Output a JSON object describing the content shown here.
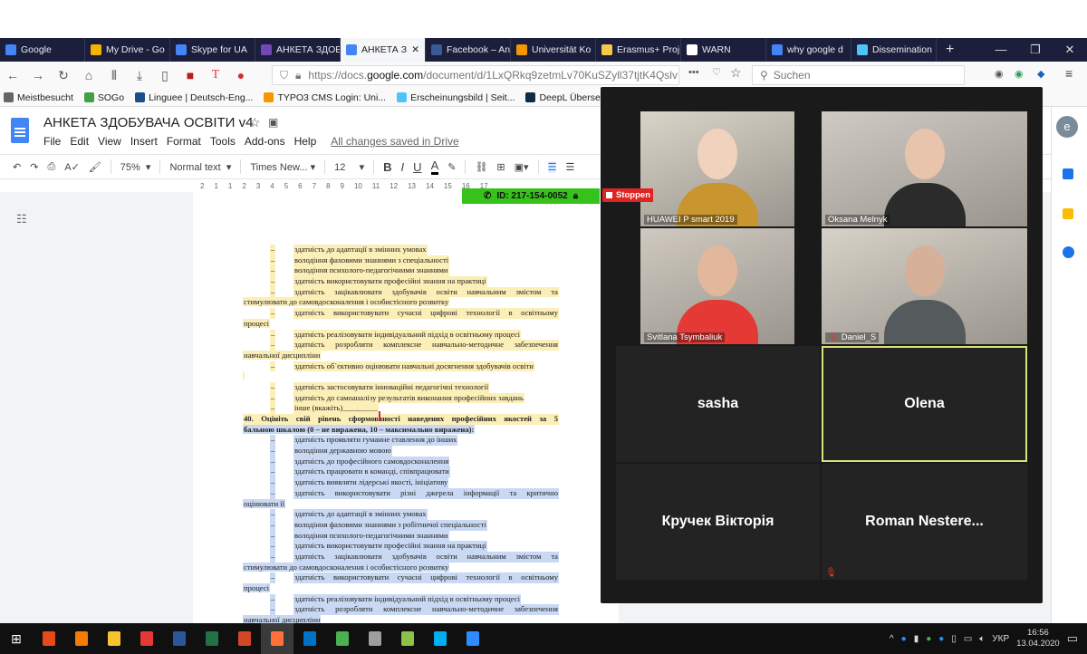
{
  "browser": {
    "tabs": [
      {
        "label": "Google",
        "icon": "google-icon",
        "color": "#4285f4"
      },
      {
        "label": "My Drive - Go",
        "icon": "drive-icon",
        "color": "#f4b400"
      },
      {
        "label": "Skype for UA",
        "icon": "docs-icon",
        "color": "#4285f4"
      },
      {
        "label": "АНКЕТА ЗДОБ",
        "icon": "forms-icon",
        "color": "#7248b9"
      },
      {
        "label": "АНКЕТА З",
        "icon": "docs-icon",
        "color": "#4285f4",
        "active": true
      },
      {
        "label": "Facebook – An",
        "icon": "facebook-icon",
        "color": "#3b5998"
      },
      {
        "label": "Universität Ko",
        "icon": "typo3-icon",
        "color": "#f49700"
      },
      {
        "label": "Erasmus+ Proj",
        "icon": "page-icon",
        "color": "#f7c948"
      },
      {
        "label": "WARN",
        "icon": "globe-icon",
        "color": "#ffffff"
      },
      {
        "label": "why google d",
        "icon": "google-icon",
        "color": "#4285f4"
      },
      {
        "label": "Dissemination",
        "icon": "page-icon",
        "color": "#4fc3f7"
      }
    ],
    "url": {
      "prefix": "https://docs.",
      "domain": "google.com",
      "path": "/document/d/1LxQRkq9zetmLv70KuSZyll37tjtK4Qslv"
    },
    "search_placeholder": "Suchen",
    "bookmarks": [
      {
        "label": "Meistbesucht",
        "color": "#666666"
      },
      {
        "label": "SOGo",
        "color": "#43a047"
      },
      {
        "label": "Linguee | Deutsch-Eng...",
        "color": "#1a4f8b"
      },
      {
        "label": "TYPO3 CMS Login: Uni...",
        "color": "#f49700"
      },
      {
        "label": "Erscheinungsbild | Seit...",
        "color": "#4fc3f7"
      },
      {
        "label": "DeepL Übersetzer",
        "color": "#0f2b46"
      },
      {
        "label": "Словарь",
        "color": "#3f7fd8"
      }
    ]
  },
  "docs": {
    "title": "АНКЕТА ЗДОБУВАЧА ОСВІТИ v4",
    "menus": [
      "File",
      "Edit",
      "View",
      "Insert",
      "Format",
      "Tools",
      "Add-ons",
      "Help"
    ],
    "saved_status": "All changes saved in Drive",
    "toolbar": {
      "zoom": "75%",
      "style": "Normal text",
      "font": "Times New...",
      "size": "12"
    },
    "ruler": [
      "2",
      "1",
      "1",
      "2",
      "3",
      "4",
      "5",
      "6",
      "7",
      "8",
      "9",
      "10",
      "11",
      "12",
      "13",
      "14",
      "15",
      "16",
      "17"
    ],
    "lines": [
      {
        "type": "item",
        "hl": "y",
        "text": "здатність до адаптації в змінних умовах"
      },
      {
        "type": "item",
        "hl": "y",
        "text": "володіння фаховими знаннями з спеціальності"
      },
      {
        "type": "item",
        "hl": "y",
        "text": "володіння психолого-педагогічними знаннями"
      },
      {
        "type": "item",
        "hl": "y",
        "text": "здатність використовувати професійні знання на практиці"
      },
      {
        "type": "item just",
        "hl": "y",
        "text": "здатність зацікавлювати здобувачів освіти навчальним змістом та"
      },
      {
        "type": "cont",
        "hl": "y",
        "text": "стимулювати до самовдосконалення і особистісного розвитку"
      },
      {
        "type": "item just",
        "hl": "y",
        "text": "здатність використовувати сучасні цифрові технології в освітньому"
      },
      {
        "type": "cont",
        "hl": "y",
        "text": "процесі"
      },
      {
        "type": "item",
        "hl": "y",
        "text": "здатність реалізовувати індивідуальний підхід в освітньому процесі"
      },
      {
        "type": "item just",
        "hl": "y",
        "text": "здатність розробляти комплексне навчально-методичне забезпечення"
      },
      {
        "type": "cont",
        "hl": "y",
        "text": "навчальної дисципліни"
      },
      {
        "type": "item",
        "hl": "y",
        "text": "здатність об`єктивно оцінювати навчальні досягнення здобувачів освіти"
      },
      {
        "type": "cont",
        "hl": "y",
        "text": "      "
      },
      {
        "type": "item",
        "hl": "y",
        "text": "здатність застосовувати інноваційні педагогічні технології"
      },
      {
        "type": "item",
        "hl": "y",
        "text": "здатність до самоаналізу результатів виконання професійних завдань"
      },
      {
        "type": "item",
        "hl": "y",
        "text": "інше (вкажіть)_________"
      },
      {
        "type": "head",
        "hl": "y",
        "text": "40. Оцініть свій рівень сформованості наведених професійних якостей за 5"
      },
      {
        "type": "headend",
        "hl": "b",
        "text": "бальною шкалою (0 – не виражена, 10 – максимально виражена):"
      },
      {
        "type": "item",
        "hl": "b",
        "text": "здатність проявляти гуманне ставлення до інших"
      },
      {
        "type": "item",
        "hl": "b",
        "text": "володіння державною мовою"
      },
      {
        "type": "item",
        "hl": "b",
        "text": "здатність до професійного самовдосконалення"
      },
      {
        "type": "item",
        "hl": "b",
        "text": "здатність працювати в команді, співпрацювати"
      },
      {
        "type": "item",
        "hl": "b",
        "text": "здатність виявляти лідерські якості, ініціативу"
      },
      {
        "type": "item just",
        "hl": "b",
        "text": "здатність використовувати різні джерела інформації та критично"
      },
      {
        "type": "cont",
        "hl": "b",
        "text": "оцінювати її"
      },
      {
        "type": "item",
        "hl": "b",
        "text": "здатність до адаптації в змінних умовах"
      },
      {
        "type": "item",
        "hl": "b",
        "text": "володіння фаховими знаннями з робітничої спеціальності"
      },
      {
        "type": "item",
        "hl": "b",
        "text": "володіння психолого-педагогічними знаннями"
      },
      {
        "type": "item",
        "hl": "b",
        "text": "здатність використовувати професійні знання на практиці"
      },
      {
        "type": "item just",
        "hl": "b",
        "text": "здатність зацікавлювати здобувачів освіти навчальним змістом та"
      },
      {
        "type": "cont",
        "hl": "b",
        "text": "стимулювати до самовдосконалення і особистісного розвитку"
      },
      {
        "type": "item just",
        "hl": "b",
        "text": "здатність використовувати сучасні цифрові технології в освітньому"
      },
      {
        "type": "cont",
        "hl": "b",
        "text": "процесі"
      },
      {
        "type": "item",
        "hl": "b",
        "text": "здатність реалізовувати індивідуальний підхід в освітньому процесі"
      },
      {
        "type": "item just",
        "hl": "b",
        "text": "здатність розробляти комплексне навчально-методичне забезпечення"
      },
      {
        "type": "cont",
        "hl": "b",
        "text": "навчальної дисципліни"
      }
    ]
  },
  "meeting": {
    "id_label": "ID: 217-154-0052",
    "stop_label": "Stoppen",
    "participants": [
      {
        "name": "HUAWEI P smart 2019"
      },
      {
        "name": "Oksana Melnyk"
      },
      {
        "name": "Svitlana Tsymbaliuk"
      },
      {
        "name": "Daniel_S",
        "muted": true
      },
      {
        "name": "sasha"
      },
      {
        "name": "Olena",
        "active_speaker": true
      },
      {
        "name": "Кручек Вікторія"
      },
      {
        "name": "Roman  Nestere...",
        "muted": true
      }
    ]
  },
  "taskbar": {
    "apps": [
      {
        "name": "office",
        "color": "#e64a19"
      },
      {
        "name": "media-player",
        "color": "#f57c00"
      },
      {
        "name": "file-explorer",
        "color": "#f4c430"
      },
      {
        "name": "acrobat",
        "color": "#e53935"
      },
      {
        "name": "word",
        "color": "#2b579a"
      },
      {
        "name": "excel",
        "color": "#217346"
      },
      {
        "name": "powerpoint",
        "color": "#d24726"
      },
      {
        "name": "firefox",
        "color": "#ff7139"
      },
      {
        "name": "outlook",
        "color": "#0072c6"
      },
      {
        "name": "browser",
        "color": "#4caf50"
      },
      {
        "name": "tool",
        "color": "#9e9e9e"
      },
      {
        "name": "paint",
        "color": "#8bc34a"
      },
      {
        "name": "skype",
        "color": "#00aff0"
      },
      {
        "name": "zoom",
        "color": "#2d8cff"
      }
    ],
    "language": "УКР",
    "time": "16:56",
    "date": "13.04.2020"
  }
}
